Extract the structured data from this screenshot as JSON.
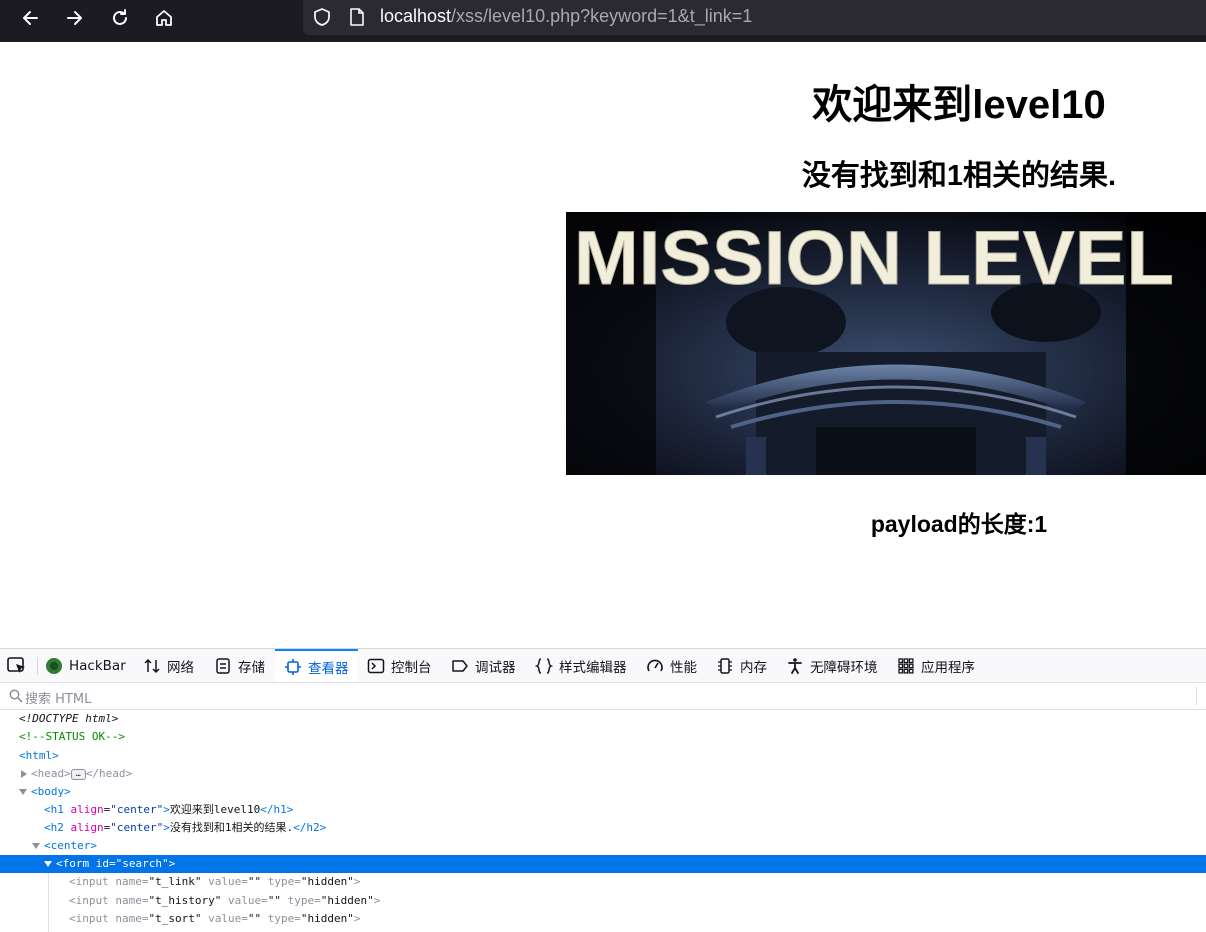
{
  "browser": {
    "url_host": "localhost",
    "url_path": "/xss/level10.php?keyword=1&t_link=1",
    "icons": [
      "back-arrow-icon",
      "forward-arrow-icon",
      "reload-icon",
      "home-icon",
      "shield-icon",
      "page-icon"
    ]
  },
  "page": {
    "h1": "欢迎来到level10",
    "h2": "没有找到和1相关的结果.",
    "banner_text": "MISSION LEVEL",
    "payload_text": "payload的长度:1"
  },
  "devtools": {
    "tabs": [
      {
        "label": "HackBar",
        "icon": "hackbar-icon"
      },
      {
        "label": "网络",
        "icon": "network-icon"
      },
      {
        "label": "存储",
        "icon": "storage-icon"
      },
      {
        "label": "查看器",
        "icon": "inspector-icon",
        "active": true
      },
      {
        "label": "控制台",
        "icon": "console-icon"
      },
      {
        "label": "调试器",
        "icon": "debugger-icon"
      },
      {
        "label": "样式编辑器",
        "icon": "style-editor-icon"
      },
      {
        "label": "性能",
        "icon": "performance-icon"
      },
      {
        "label": "内存",
        "icon": "memory-icon"
      },
      {
        "label": "无障碍环境",
        "icon": "accessibility-icon"
      },
      {
        "label": "应用程序",
        "icon": "application-icon"
      }
    ],
    "search_placeholder": "搜索 HTML",
    "tree": {
      "doctype": "<!DOCTYPE html>",
      "comment": "<!--STATUS OK-->",
      "html_open": "<html>",
      "head_open": "<head>",
      "head_ellipsis": "…",
      "head_close": "</head>",
      "body_open": "<body>",
      "h1_tag": "h1",
      "h1_attr_name": "align",
      "h1_attr_value": "\"center\"",
      "h1_text": "欢迎来到level10",
      "h1_close": "</h1>",
      "h2_tag": "h2",
      "h2_attr_name": "align",
      "h2_attr_value": "\"center\"",
      "h2_text": "没有找到和1相关的结果.",
      "h2_close": "</h2>",
      "center_open": "<center>",
      "form_line": "<form id=\"search\">",
      "inputs": [
        {
          "name": "\"t_link\"",
          "value": "\"\"",
          "type": "\"hidden\""
        },
        {
          "name": "\"t_history\"",
          "value": "\"\"",
          "type": "\"hidden\""
        },
        {
          "name": "\"t_sort\"",
          "value": "\"\"",
          "type": "\"hidden\""
        }
      ],
      "attr_labels": {
        "input": "<input",
        "name": "name=",
        "value": "value=",
        "type": "type=",
        "close": ">"
      }
    }
  }
}
